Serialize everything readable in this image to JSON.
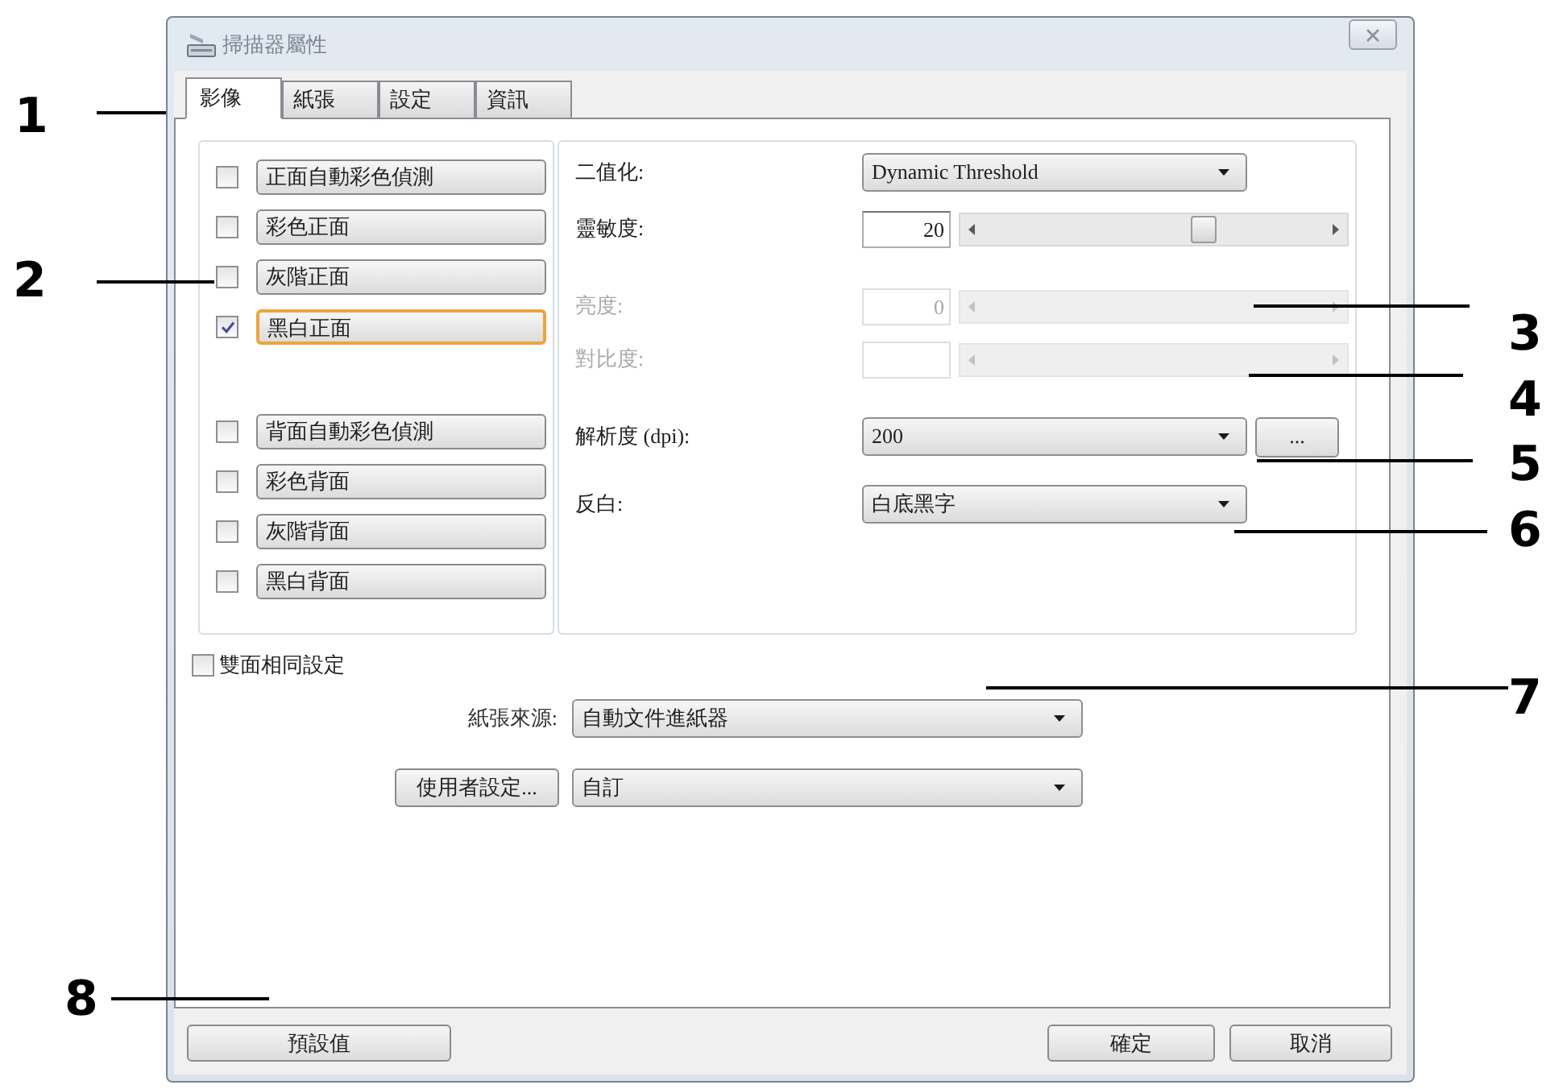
{
  "window": {
    "title": "掃描器屬性"
  },
  "tabs": [
    {
      "label": "影像",
      "selected": true
    },
    {
      "label": "紙張",
      "selected": false
    },
    {
      "label": "設定",
      "selected": false
    },
    {
      "label": "資訊",
      "selected": false
    }
  ],
  "front": [
    {
      "label": "正面自動彩色偵測",
      "checked": false,
      "selected": false
    },
    {
      "label": "彩色正面",
      "checked": false,
      "selected": false
    },
    {
      "label": "灰階正面",
      "checked": false,
      "selected": false
    },
    {
      "label": "黑白正面",
      "checked": true,
      "selected": true
    }
  ],
  "back": [
    {
      "label": "背面自動彩色偵測",
      "checked": false,
      "selected": false
    },
    {
      "label": "彩色背面",
      "checked": false,
      "selected": false
    },
    {
      "label": "灰階背面",
      "checked": false,
      "selected": false
    },
    {
      "label": "黑白背面",
      "checked": false,
      "selected": false
    }
  ],
  "settings": [
    {
      "kind": "dropdown",
      "label": "二值化:",
      "value": "Dynamic Threshold",
      "disabled": false
    },
    {
      "kind": "slider",
      "label": "靈敏度:",
      "value": "20",
      "level": 0.65,
      "disabled": false
    },
    {
      "kind": "slider",
      "label": "亮度:",
      "value": "0",
      "disabled": true
    },
    {
      "kind": "slider",
      "label": "對比度:",
      "disabled": true
    },
    {
      "kind": "dropdown",
      "label": "解析度 (dpi):",
      "value": "200",
      "button": "...",
      "disabled": false
    },
    {
      "kind": "dropdown",
      "label": "反白:",
      "value": "白底黑字",
      "disabled": false
    }
  ],
  "duplex_same": {
    "label": "雙面相同設定",
    "checked": false
  },
  "paper_source": {
    "label": "紙張來源:",
    "value": "自動文件進紙器"
  },
  "user_settings": {
    "button": "使用者設定...",
    "value": "自訂"
  },
  "footer": {
    "defaults": "預設值",
    "ok": "確定",
    "cancel": "取消"
  },
  "callouts": [
    {
      "label": "1"
    },
    {
      "label": "2"
    },
    {
      "label": "3"
    },
    {
      "label": "4"
    },
    {
      "label": "5"
    },
    {
      "label": "6"
    },
    {
      "label": "7"
    },
    {
      "label": "8"
    }
  ]
}
